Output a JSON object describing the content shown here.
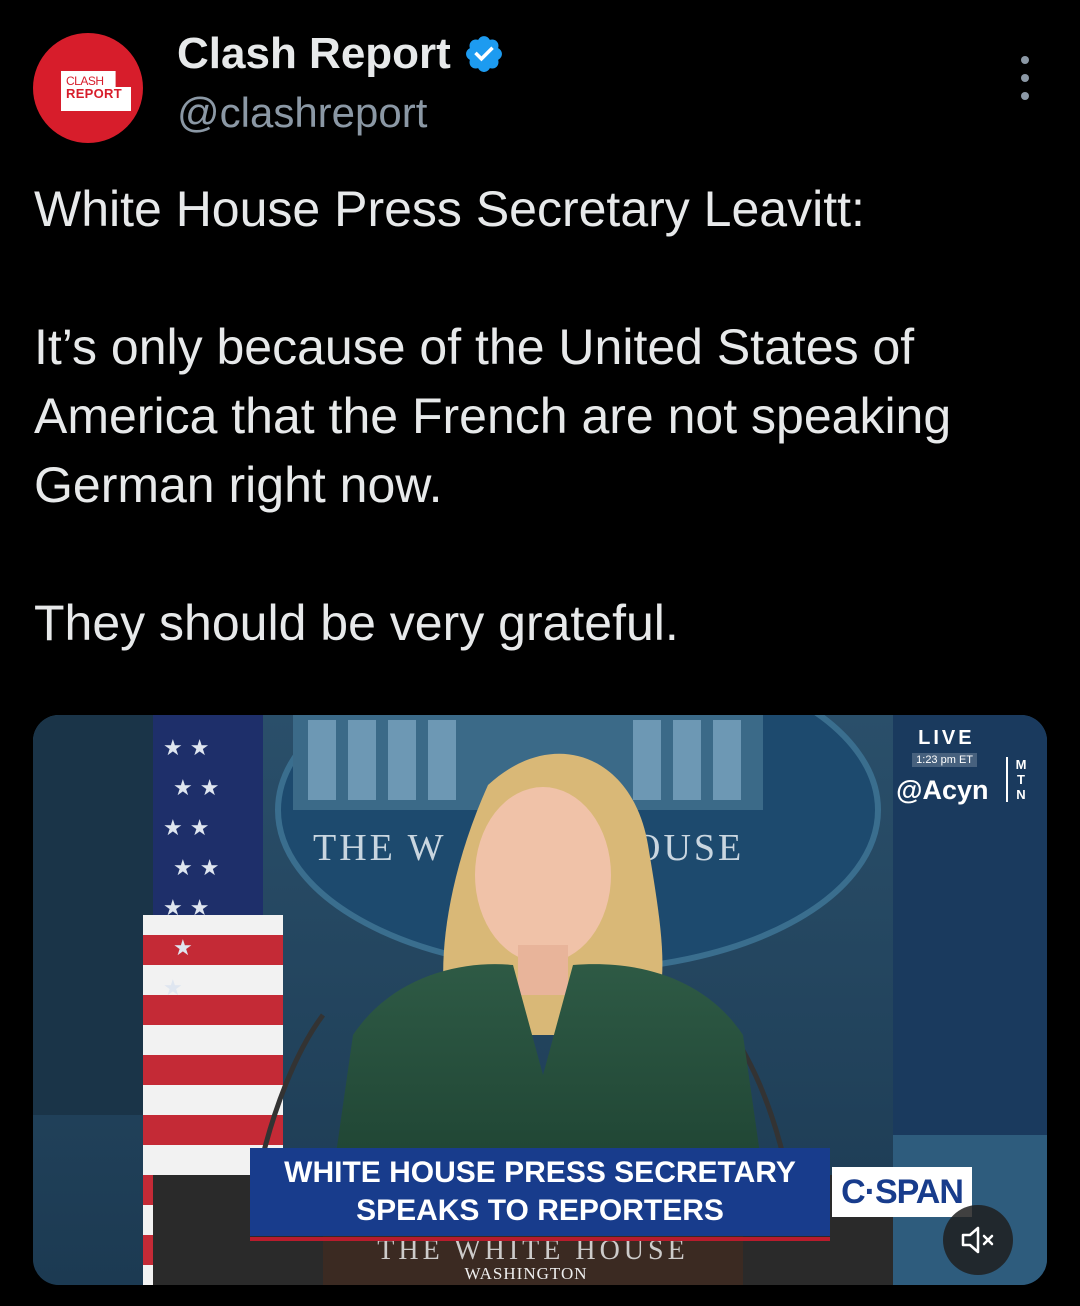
{
  "author": {
    "name": "Clash Report",
    "handle": "@clashreport",
    "avatar_text_line1": "CLASH",
    "avatar_text_line2": "REPORT",
    "verified_icon": "verified-badge-icon"
  },
  "post": {
    "paragraphs": [
      "White House Press Secretary Leavitt:",
      "It’s only because of the United States of America that the French are not speaking German right now.",
      "They should be very grateful."
    ]
  },
  "media": {
    "live_label": "LIVE",
    "time": "1:23 pm ET",
    "watermark": "@Acyn",
    "network_letters": "M\nT\nN",
    "backdrop_text_left": "THE W",
    "backdrop_text_right": "OUSE",
    "chyron_line1": "WHITE HOUSE PRESS SECRETARY",
    "chyron_line2": "SPEAKS TO REPORTERS",
    "podium_text": "THE WHITE HOUSE",
    "podium_subtext": "WASHINGTON",
    "network_logo": "C·SPAN",
    "mute_icon": "muted-speaker-icon"
  },
  "colors": {
    "background": "#000000",
    "text": "#e7e9ea",
    "secondary_text": "#8b98a5",
    "verified": "#1d9bf0",
    "avatar_red": "#d71d2b",
    "chyron_blue": "#183c8c"
  }
}
